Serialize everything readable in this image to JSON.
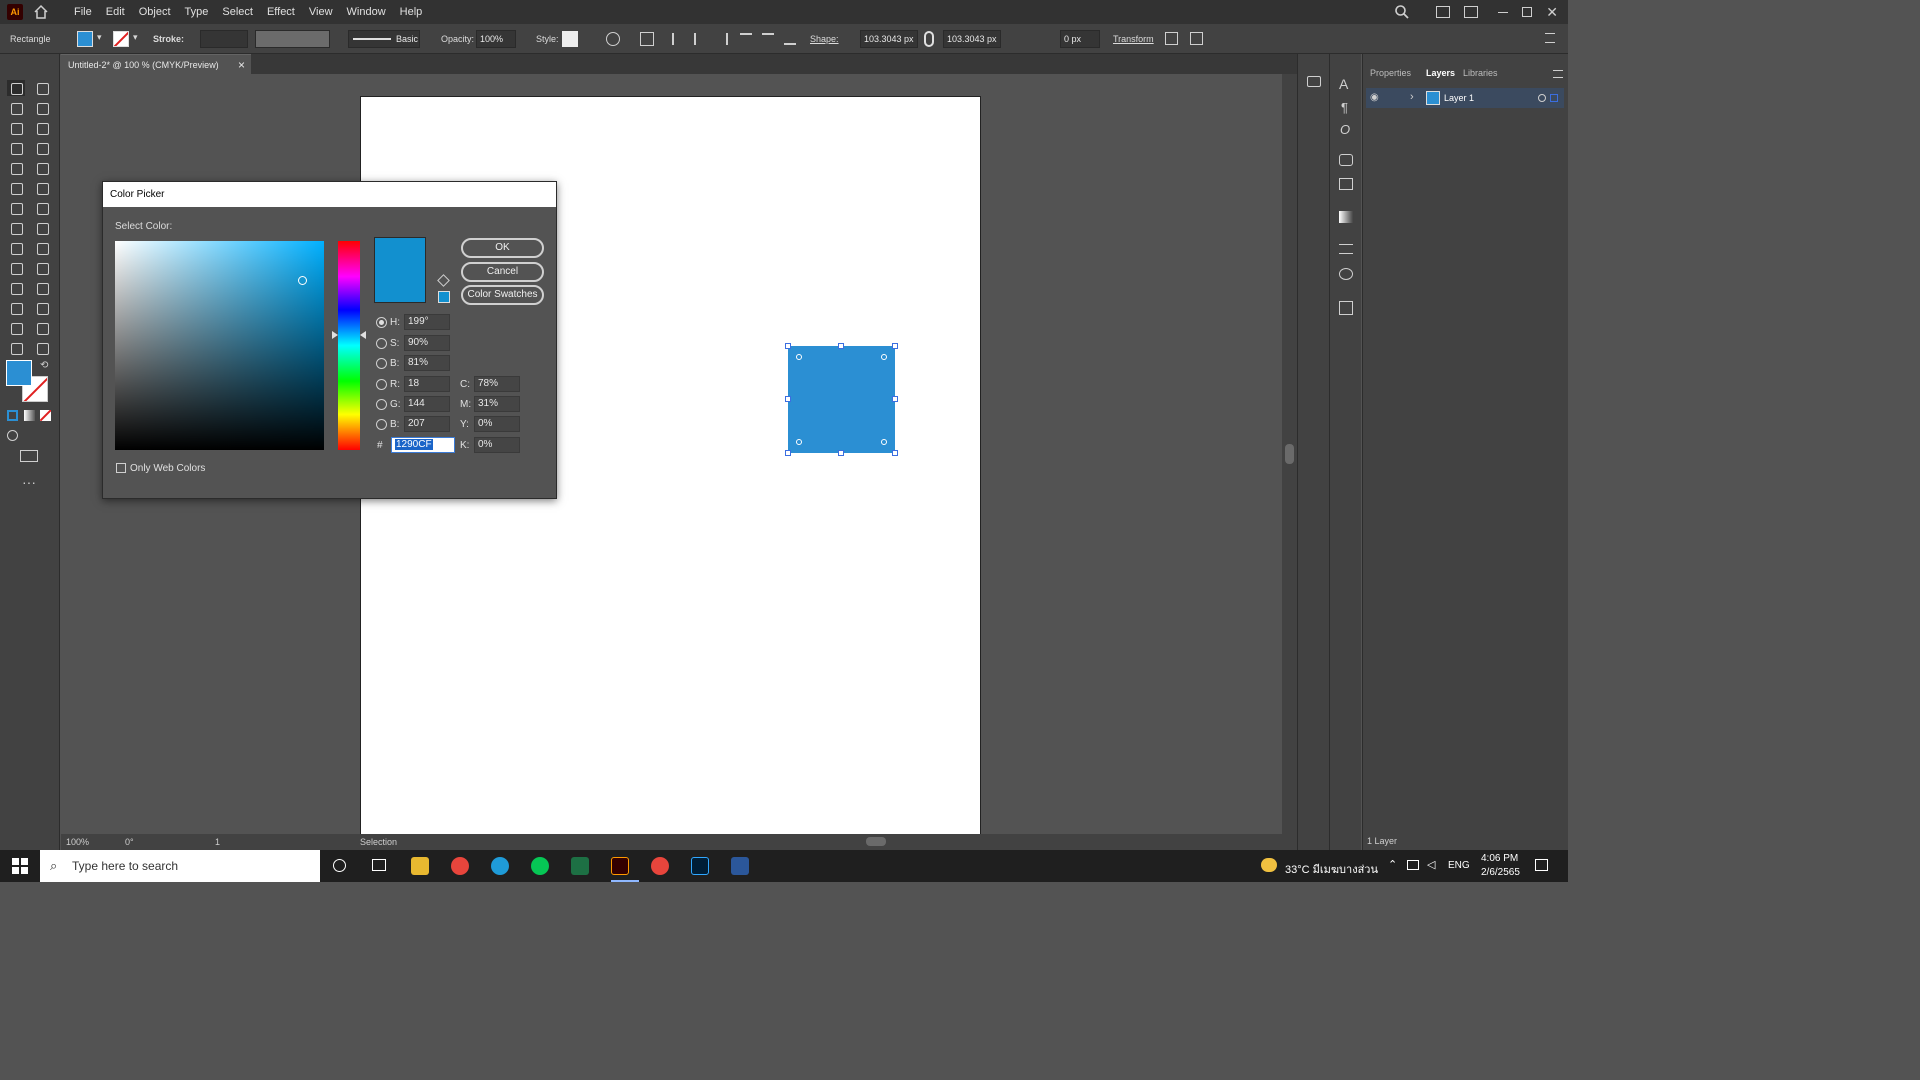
{
  "menubar": {
    "logo": "Ai",
    "items": [
      "File",
      "Edit",
      "Object",
      "Type",
      "Select",
      "Effect",
      "View",
      "Window",
      "Help"
    ]
  },
  "controlbar": {
    "tool_name": "Rectangle",
    "stroke_label": "Stroke:",
    "brush_label": "Basic",
    "opacity_label": "Opacity:",
    "opacity_value": "100%",
    "style_label": "Style:",
    "shape_label": "Shape:",
    "width_value": "103.3043 px",
    "height_value": "103.3043 px",
    "corner_value": "0 px",
    "transform_label": "Transform"
  },
  "document": {
    "tab_title": "Untitled-2* @ 100 % (CMYK/Preview)",
    "close_glyph": "×"
  },
  "colors": {
    "selected_fill": "#1290cf",
    "shape_fill": "#2b8fd3"
  },
  "color_picker": {
    "title": "Color Picker",
    "select_label": "Select Color:",
    "ok_label": "OK",
    "cancel_label": "Cancel",
    "swatches_label": "Color Swatches",
    "web_only_label": "Only Web Colors",
    "fields": {
      "h": {
        "label": "H:",
        "value": "199°"
      },
      "s": {
        "label": "S:",
        "value": "90%"
      },
      "b": {
        "label": "B:",
        "value": "81%"
      },
      "r": {
        "label": "R:",
        "value": "18"
      },
      "g": {
        "label": "G:",
        "value": "144"
      },
      "bl": {
        "label": "B:",
        "value": "207"
      },
      "hex": {
        "label": "#",
        "value": "1290CF"
      },
      "c": {
        "label": "C:",
        "value": "78%"
      },
      "m": {
        "label": "M:",
        "value": "31%"
      },
      "y": {
        "label": "Y:",
        "value": "0%"
      },
      "k": {
        "label": "K:",
        "value": "0%"
      }
    }
  },
  "panel": {
    "tabs": [
      "Properties",
      "Layers",
      "Libraries"
    ],
    "layer_name": "Layer 1",
    "footer": "1 Layer"
  },
  "status": {
    "zoom": "100%",
    "rotation": "0°",
    "artboard": "1",
    "tool": "Selection"
  },
  "taskbar": {
    "search_placeholder": "Type here to search",
    "weather": "33°C มีเมฆบางส่วน",
    "lang": "ENG",
    "time": "4:06 PM",
    "date": "2/6/2565"
  }
}
